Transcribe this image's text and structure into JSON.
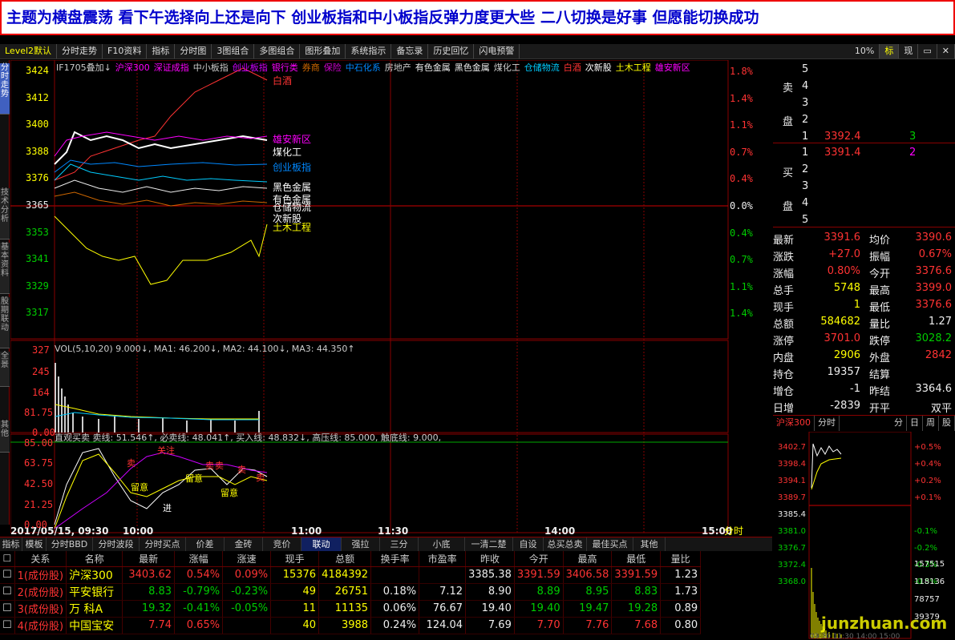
{
  "banner": "主题为横盘震荡 看下午选择向上还是向下 创业板指和中小板指反弹力度更大些 二八切换是好事 但愿能切换成功",
  "toolbar": {
    "items": [
      "Level2默认",
      "分时走势",
      "F10资料",
      "指标",
      "分时图",
      "3图组合",
      "多图组合",
      "图形叠加",
      "系统指示",
      "备忘录",
      "历史回忆",
      "闪电预警"
    ],
    "pct": "10%",
    "biao": "标",
    "xian": "现"
  },
  "leftnav": [
    "分时走势",
    "技术分析",
    "基本资料",
    "股期联动",
    "全景",
    "其他"
  ],
  "chart": {
    "legend": [
      {
        "t": "IF1705叠加↓",
        "c": "#ccc"
      },
      {
        "t": "沪深300",
        "c": "#f0f"
      },
      {
        "t": "深证成指",
        "c": "#f0f"
      },
      {
        "t": "中小板指",
        "c": "#ccc"
      },
      {
        "t": "创业板指",
        "c": "#c0f"
      },
      {
        "t": "银行类",
        "c": "#f0f"
      },
      {
        "t": "券商",
        "c": "#c60"
      },
      {
        "t": "保险",
        "c": "#c0c"
      },
      {
        "t": "中石化系",
        "c": "#08f"
      },
      {
        "t": "房地产",
        "c": "#ccc"
      },
      {
        "t": "有色金属",
        "c": "#eee"
      },
      {
        "t": "黑色金属",
        "c": "#eee"
      },
      {
        "t": "煤化工",
        "c": "#ccc"
      },
      {
        "t": "仓储物流",
        "c": "#0cf"
      },
      {
        "t": "白酒",
        "c": "#f33"
      },
      {
        "t": "次新股",
        "c": "#fff"
      },
      {
        "t": "土木工程",
        "c": "#ff0"
      },
      {
        "t": "雄安新区",
        "c": "#f0f"
      }
    ],
    "y_left": [
      "3424",
      "3412",
      "3400",
      "3388",
      "3376",
      "3365",
      "3353",
      "3341",
      "3329",
      "3317"
    ],
    "y_right": [
      "1.8%",
      "1.4%",
      "1.1%",
      "0.7%",
      "0.4%",
      "0.0%",
      "0.4%",
      "0.7%",
      "1.1%",
      "1.4%"
    ],
    "tags": [
      "白酒",
      "雄安新区",
      "煤化工",
      "创业板指",
      "黑色金属",
      "有色金属",
      "仓储物流",
      "次新股",
      "土木工程"
    ],
    "vol_header": "VOL(5,10,20)  9.000↓, MA1: 46.200↓, MA2: 44.100↓, MA3: 44.350↑",
    "vol_y": [
      "327",
      "245",
      "164",
      "81.75",
      "0.00"
    ],
    "ind_header": "直观买卖  卖线: 51.546↑, 必卖线: 48.041↑, 买入线: 48.832↓, 高压线: 85.000, 触底线: 9.000,",
    "ind_y": [
      "85.00",
      "63.75",
      "42.50",
      "21.25",
      "0.00"
    ],
    "ind_marks": [
      "卖",
      "关注",
      "卖",
      "卖",
      "留意",
      "留意",
      "进",
      "留意",
      "卖",
      "卖"
    ],
    "time_labels": [
      "2017/05/15, 09:30",
      "10:00",
      "11:00",
      "11:30",
      "14:00",
      "15:00"
    ],
    "fen_shi": "分时"
  },
  "quote": {
    "sell_label": [
      "卖",
      "盘"
    ],
    "buy_label": [
      "买",
      "盘"
    ],
    "sell": [
      {
        "n": "5",
        "p": "",
        "v": ""
      },
      {
        "n": "4",
        "p": "",
        "v": ""
      },
      {
        "n": "3",
        "p": "",
        "v": ""
      },
      {
        "n": "2",
        "p": "",
        "v": ""
      },
      {
        "n": "1",
        "p": "3392.4",
        "v": "3"
      }
    ],
    "buy": [
      {
        "n": "1",
        "p": "3391.4",
        "v": "2"
      },
      {
        "n": "2",
        "p": "",
        "v": ""
      },
      {
        "n": "3",
        "p": "",
        "v": ""
      },
      {
        "n": "4",
        "p": "",
        "v": ""
      },
      {
        "n": "5",
        "p": "",
        "v": ""
      }
    ],
    "stats": [
      [
        "最新",
        "3391.6",
        "均价",
        "3390.6"
      ],
      [
        "涨跌",
        "+27.0",
        "振幅",
        "0.67%"
      ],
      [
        "涨幅",
        "0.80%",
        "今开",
        "3376.6"
      ],
      [
        "总手",
        "5748",
        "最高",
        "3399.0"
      ],
      [
        "现手",
        "1",
        "最低",
        "3376.6"
      ],
      [
        "总额",
        "584682",
        "量比",
        "1.27"
      ],
      [
        "涨停",
        "3701.0",
        "跌停",
        "3028.2"
      ],
      [
        "内盘",
        "2906",
        "外盘",
        "2842"
      ],
      [
        "持仓",
        "19357",
        "结算",
        ""
      ],
      [
        "增仓",
        "-1",
        "昨结",
        "3364.6"
      ],
      [
        "日增",
        "-2839",
        "开平",
        "双平"
      ]
    ]
  },
  "mini": {
    "tabs": [
      "沪深300",
      "分时",
      "分",
      "日",
      "周",
      "股"
    ],
    "y_left": [
      "3402.7",
      "3398.4",
      "3394.1",
      "3389.7",
      "3385.4",
      "3381.0",
      "3376.7",
      "3372.4",
      "3368.0"
    ],
    "y_right": [
      "+0.5%",
      "+0.4%",
      "+0.2%",
      "+0.1%",
      "",
      "-0.1%",
      "-0.2%",
      "-0.3%",
      "-0.5%"
    ],
    "vol": [
      "157515",
      "118136",
      "78757",
      "39379"
    ],
    "watermark": "junzhuan.com",
    "bottom_time": "09:30 11:30 14:00 15:00"
  },
  "tabs2": [
    "指标",
    "模板",
    "分时BBD",
    "分时波段",
    "分时买点",
    "价差",
    "金砖",
    "竞价",
    "联动",
    "强拉",
    "三分",
    "小底",
    "一清二楚",
    "自设",
    "总买总卖",
    "最佳买点",
    "其他"
  ],
  "table": {
    "headers": [
      "关系",
      "名称",
      "最新",
      "涨幅",
      "涨速",
      "现手",
      "总额",
      "换手率",
      "市盈率",
      "昨收",
      "今开",
      "最高",
      "最低",
      "量比"
    ],
    "rows": [
      {
        "rel": "1(成份股)",
        "name": "沪深300",
        "last": "3403.62",
        "chg": "0.54%",
        "spd": "0.09%",
        "vol": "15376",
        "amt": "4184392",
        "turn": "",
        "pe": "",
        "prev": "3385.38",
        "open": "3391.59",
        "high": "3406.58",
        "low": "3391.59",
        "ratio": "1.23"
      },
      {
        "rel": "2(成份股)",
        "name": "平安银行",
        "last": "8.83",
        "chg": "-0.79%",
        "spd": "-0.23%",
        "vol": "49",
        "amt": "26751",
        "turn": "0.18%",
        "pe": "7.12",
        "prev": "8.90",
        "open": "8.89",
        "high": "8.95",
        "low": "8.83",
        "ratio": "1.73"
      },
      {
        "rel": "3(成份股)",
        "name": "万 科A",
        "last": "19.32",
        "chg": "-0.41%",
        "spd": "-0.05%",
        "vol": "11",
        "amt": "11135",
        "turn": "0.06%",
        "pe": "76.67",
        "prev": "19.40",
        "open": "19.40",
        "high": "19.47",
        "low": "19.28",
        "ratio": "0.89"
      },
      {
        "rel": "4(成份股)",
        "name": "中国宝安",
        "last": "7.74",
        "chg": "0.65%",
        "spd": "",
        "vol": "40",
        "amt": "3988",
        "turn": "0.24%",
        "pe": "124.04",
        "prev": "7.69",
        "open": "7.70",
        "high": "7.76",
        "low": "7.68",
        "ratio": "0.80"
      }
    ]
  }
}
